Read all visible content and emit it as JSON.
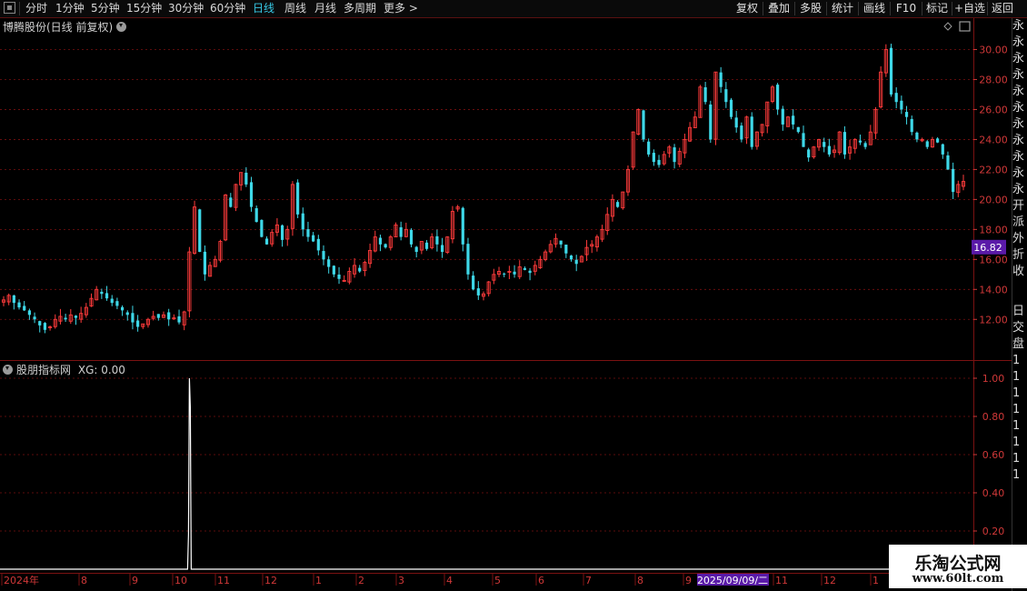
{
  "toolbar": {
    "periods": [
      "分时",
      "1分钟",
      "5分钟",
      "15分钟",
      "30分钟",
      "60分钟",
      "日线",
      "周线",
      "月线",
      "多周期",
      "更多 >"
    ],
    "active_period": "日线",
    "buttons": [
      "复权",
      "叠加",
      "多股",
      "统计",
      "画线",
      "F10",
      "标记",
      "+自选",
      "返回"
    ]
  },
  "main_panel": {
    "title": "博腾股份(日线 前复权)",
    "price_tag": "16.82",
    "price_tag_color": "#5a1aa8"
  },
  "indicator_panel": {
    "title": "股朋指标网",
    "readout": "XG: 0.00"
  },
  "right_column_glyphs": [
    "永",
    "永",
    "永",
    "永",
    "永",
    "永",
    "永",
    "永",
    "永",
    "永",
    "永",
    "开",
    "派",
    "外",
    "折",
    "收"
  ],
  "right_column_glyphs_lower": [
    "日",
    "交",
    "盘",
    "1",
    "1",
    "1",
    "1",
    "1",
    "1",
    "1",
    "1"
  ],
  "time_axis": {
    "labels": [
      "2024年",
      "8",
      "9",
      "10",
      "11",
      "12",
      "1",
      "2",
      "3",
      "4",
      "5",
      "6",
      "7",
      "8",
      "9",
      "11",
      "12",
      "1"
    ],
    "cursor_label": "2025/09/09/二"
  },
  "watermark": {
    "line1": "乐淘公式网",
    "line2": "www.60lt.com"
  },
  "colors": {
    "up": "#ff3b3b",
    "down": "#3ed8e8",
    "grid": "#7a1010",
    "axis_text": "#d03838",
    "indicator_line": "#ffffff"
  },
  "chart_data": [
    {
      "type": "candlestick",
      "series_name": "博腾股份",
      "ylim": [
        10.5,
        31
      ],
      "yticks": [
        12.0,
        14.0,
        16.0,
        18.0,
        20.0,
        22.0,
        24.0,
        26.0,
        28.0,
        30.0
      ],
      "close_path": [
        13.3,
        13.6,
        13.1,
        12.8,
        12.6,
        12.3,
        12.0,
        11.6,
        11.3,
        11.5,
        12.0,
        12.2,
        12.0,
        12.3,
        12.1,
        12.4,
        12.8,
        13.4,
        14.0,
        13.7,
        13.4,
        13.1,
        12.9,
        12.6,
        12.3,
        11.8,
        11.5,
        11.7,
        12.0,
        12.2,
        12.1,
        12.3,
        12.0,
        12.1,
        11.8,
        12.5,
        16.5,
        19.5,
        16.5,
        15.0,
        15.6,
        16.0,
        17.2,
        20.3,
        19.5,
        21.0,
        21.8,
        21.0,
        19.5,
        18.5,
        17.5,
        17.0,
        17.8,
        18.3,
        17.3,
        18.0,
        21.0,
        19.0,
        18.0,
        17.5,
        17.2,
        16.6,
        16.0,
        15.5,
        15.0,
        14.7,
        14.6,
        15.2,
        15.6,
        15.2,
        15.8,
        16.6,
        17.5,
        17.0,
        16.8,
        17.5,
        18.3,
        17.5,
        18.0,
        17.0,
        16.5,
        17.2,
        16.7,
        17.5,
        17.0,
        16.5,
        17.5,
        19.2,
        19.5,
        17.0,
        15.0,
        14.0,
        13.6,
        13.7,
        14.5,
        15.0,
        15.2,
        15.0,
        15.2,
        15.0,
        15.5,
        15.3,
        15.1,
        15.6,
        16.0,
        16.5,
        17.0,
        17.4,
        17.0,
        16.4,
        16.0,
        15.7,
        16.2,
        16.8,
        17.0,
        17.5,
        18.0,
        19.0,
        20.0,
        19.5,
        20.5,
        22.0,
        24.5,
        26.0,
        24.0,
        23.0,
        22.5,
        22.3,
        23.0,
        23.5,
        22.5,
        23.2,
        24.0,
        24.8,
        25.5,
        27.5,
        26.5,
        24.0,
        28.5,
        27.5,
        26.5,
        25.5,
        24.8,
        24.0,
        25.5,
        23.5,
        24.5,
        25.0,
        26.5,
        27.5,
        26.0,
        25.0,
        25.5,
        25.0,
        24.5,
        23.5,
        22.8,
        23.5,
        24.0,
        23.5,
        23.0,
        23.3,
        24.5,
        23.0,
        23.5,
        24.0,
        23.8,
        23.5,
        24.5,
        26.0,
        28.5,
        30.0,
        27.0,
        26.5,
        26.0,
        25.5,
        24.5,
        24.0,
        24.0,
        23.5,
        24.0,
        23.8,
        23.0,
        22.0,
        20.5,
        21.0,
        21.2
      ],
      "price_tag": 16.82
    },
    {
      "type": "line",
      "series": [
        {
          "name": "XG",
          "values": [
            0,
            0,
            0,
            0,
            1,
            0,
            0,
            0,
            0,
            0
          ]
        }
      ],
      "ylim": [
        0,
        1.0
      ],
      "yticks": [
        0.2,
        0.4,
        0.6,
        0.8,
        1.0
      ],
      "signal_bar_index": 36,
      "signal_value": 1.0
    }
  ]
}
